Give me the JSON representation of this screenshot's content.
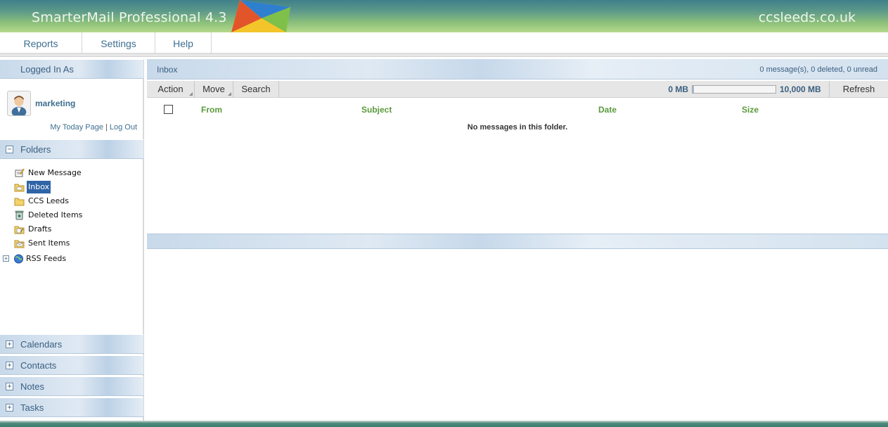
{
  "header": {
    "app_title": "SmarterMail Professional 4.3",
    "domain": "ccsleeds.co.uk"
  },
  "menu": {
    "items": [
      {
        "label": "Reports"
      },
      {
        "label": "Settings"
      },
      {
        "label": "Help"
      }
    ]
  },
  "sidebar": {
    "logged_in_header": "Logged In As",
    "username": "marketing",
    "my_today_link": "My Today Page",
    "separator": "|",
    "logout_link": "Log Out",
    "folders_header": "Folders",
    "folders": [
      {
        "label": "New Message",
        "icon": "new-message-icon"
      },
      {
        "label": "Inbox",
        "icon": "inbox-folder-icon",
        "selected": true
      },
      {
        "label": "CCS Leeds",
        "icon": "folder-icon"
      },
      {
        "label": "Deleted Items",
        "icon": "deleted-items-icon"
      },
      {
        "label": "Drafts",
        "icon": "drafts-folder-icon"
      },
      {
        "label": "Sent Items",
        "icon": "sent-items-icon"
      },
      {
        "label": "RSS Feeds",
        "icon": "rss-globe-icon"
      }
    ],
    "sections": [
      {
        "label": "Calendars"
      },
      {
        "label": "Contacts"
      },
      {
        "label": "Notes"
      },
      {
        "label": "Tasks"
      }
    ]
  },
  "main": {
    "title": "Inbox",
    "stats": "0 message(s), 0 deleted, 0 unread",
    "toolbar": {
      "action": "Action",
      "move": "Move",
      "search": "Search",
      "quota_used": "0 MB",
      "quota_total": "10,000 MB",
      "quota_fraction": 0.0,
      "refresh": "Refresh"
    },
    "columns": {
      "from": "From",
      "subject": "Subject",
      "date": "Date",
      "size": "Size"
    },
    "empty_message": "No messages in this folder."
  },
  "colors": {
    "accent_blue": "#3e6f90",
    "column_green": "#5a9a3c",
    "selection_blue": "#2f64a6"
  }
}
